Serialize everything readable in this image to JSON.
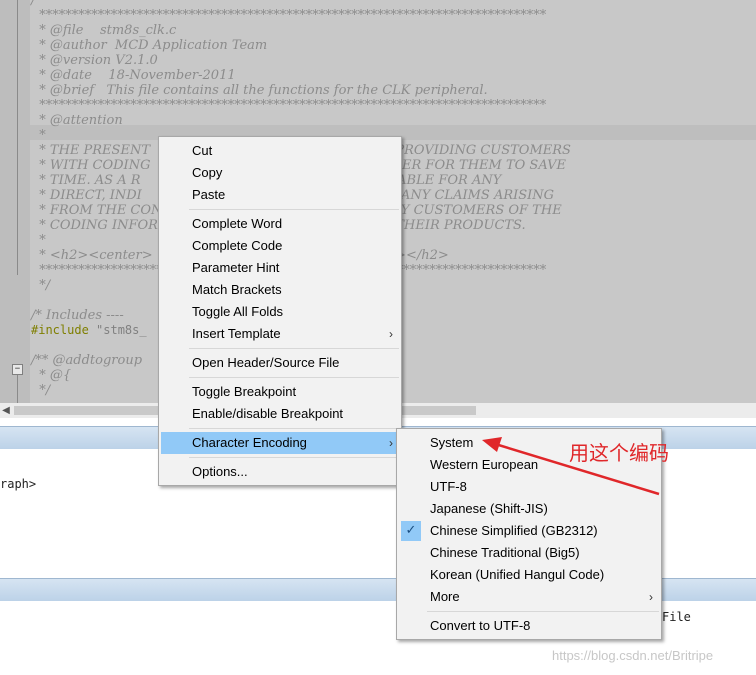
{
  "editor": {
    "code_lines": [
      "/**",
      "  ******************************************************************************",
      "  * @file    stm8s_clk.c",
      "  * @author  MCD Application Team",
      "  * @version V2.1.0",
      "  * @date    18-November-2011",
      "  * @brief   This file contains all the functions for the CLK peripheral.",
      "  ******************************************************************************",
      "  * @attention",
      "  *",
      "  * THE PRESENT                                  ONLY AIMS AT PROVIDING CUSTOMERS",
      "  * WITH CODING                                 ODUCTS IN ORDER FOR THEM TO SAVE",
      "  * TIME. AS A R                               L NOT BE HELD LIABLE FOR ANY",
      "  * DIRECT, INDI                              WITH RESPECT TO ANY CLAIMS ARISING",
      "  * FROM THE CON                              HE USE MADE BY CUSTOMERS OF THE",
      "  * CODING INFOR                              NECTION WITH THEIR PRODUCTS.",
      "  *",
      "  * <h2><center>                             lectronics</center></h2>",
      "  ******************************************************************************",
      "  */",
      "",
      "/* Includes ----                              ------------------------------*/"
    ],
    "include_keyword": "#include",
    "include_fragment": "\"stm8s_",
    "after_lines": [
      "",
      "/** @addtogroup",
      "  * @{",
      "  */"
    ]
  },
  "panels": {
    "panel1_text": "raph>",
    "panel2_text": "File"
  },
  "context_menu": {
    "items": [
      {
        "label": "Cut"
      },
      {
        "label": "Copy"
      },
      {
        "label": "Paste"
      },
      {
        "label": "Complete Word"
      },
      {
        "label": "Complete Code"
      },
      {
        "label": "Parameter Hint"
      },
      {
        "label": "Match Brackets"
      },
      {
        "label": "Toggle All Folds"
      },
      {
        "label": "Insert Template",
        "submenu_icon": "chevron-right-icon"
      },
      {
        "label": "Open Header/Source File"
      },
      {
        "label": "Toggle Breakpoint"
      },
      {
        "label": "Enable/disable Breakpoint"
      },
      {
        "label": "Character Encoding",
        "submenu_icon": "chevron-right-icon",
        "highlighted": true
      },
      {
        "label": "Options..."
      }
    ],
    "submenu_glyph": "›"
  },
  "encoding_submenu": {
    "items": [
      {
        "label": "System"
      },
      {
        "label": "Western European"
      },
      {
        "label": "UTF-8"
      },
      {
        "label": "Japanese (Shift-JIS)"
      },
      {
        "label": "Chinese Simplified (GB2312)",
        "checked": true
      },
      {
        "label": "Chinese Traditional (Big5)"
      },
      {
        "label": "Korean (Unified Hangul Code)"
      },
      {
        "label": "More",
        "submenu_icon": "chevron-right-icon"
      },
      {
        "label": "Convert to UTF-8"
      }
    ],
    "check_glyph": "✓"
  },
  "annotation": {
    "text": "用这个编码",
    "color": "#e0272a"
  },
  "watermark": "https://blog.csdn.net/Britripe",
  "colors": {
    "menu_highlight": "#91c9f7",
    "editor_background": "#c8c8c8",
    "panel_bar": "#c9dbed"
  }
}
